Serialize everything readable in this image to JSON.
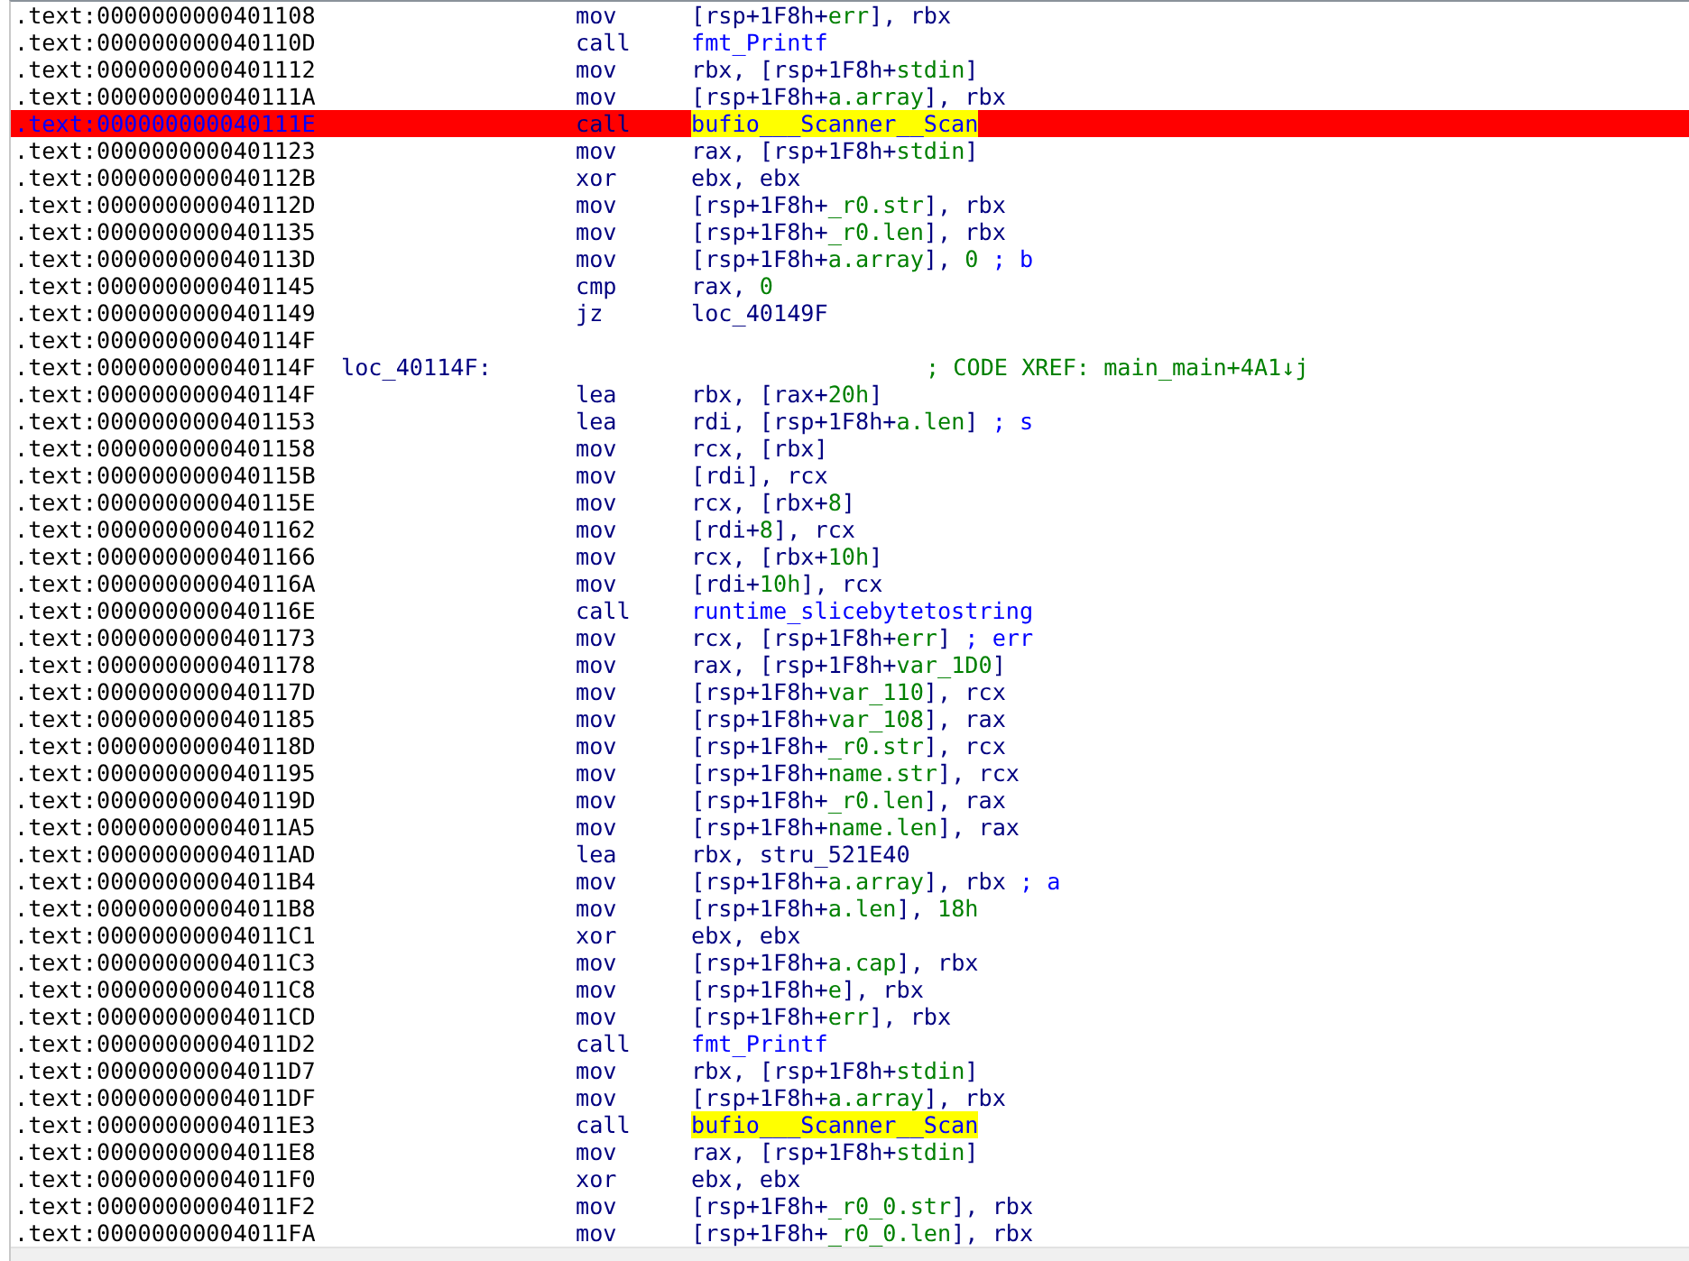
{
  "listing": {
    "rows": [
      {
        "address": ".text:0000000000401108",
        "breakpoint": false,
        "mnemonic": "mov",
        "operand": [
          {
            "text": "[rsp+1F8h+",
            "kind": "reg"
          },
          {
            "text": "err",
            "kind": "var"
          },
          {
            "text": "], rbx",
            "kind": "reg"
          }
        ]
      },
      {
        "address": ".text:000000000040110D",
        "breakpoint": false,
        "mnemonic": "call",
        "operand": [
          {
            "text": "fmt_Printf",
            "kind": "name"
          }
        ]
      },
      {
        "address": ".text:0000000000401112",
        "breakpoint": false,
        "mnemonic": "mov",
        "operand": [
          {
            "text": "rbx, [rsp+1F8h+",
            "kind": "reg"
          },
          {
            "text": "stdin",
            "kind": "var"
          },
          {
            "text": "]",
            "kind": "reg"
          }
        ]
      },
      {
        "address": ".text:000000000040111A",
        "breakpoint": false,
        "mnemonic": "mov",
        "operand": [
          {
            "text": "[rsp+1F8h+",
            "kind": "reg"
          },
          {
            "text": "a.array",
            "kind": "var"
          },
          {
            "text": "], rbx",
            "kind": "reg"
          }
        ]
      },
      {
        "address": ".text:000000000040111E",
        "breakpoint": true,
        "mnemonic": "call",
        "operand": [
          {
            "text": "bufio___Scanner__Scan",
            "kind": "highlight"
          }
        ]
      },
      {
        "address": ".text:0000000000401123",
        "breakpoint": false,
        "mnemonic": "mov",
        "operand": [
          {
            "text": "rax, [rsp+1F8h+",
            "kind": "reg"
          },
          {
            "text": "stdin",
            "kind": "var"
          },
          {
            "text": "]",
            "kind": "reg"
          }
        ]
      },
      {
        "address": ".text:000000000040112B",
        "breakpoint": false,
        "mnemonic": "xor",
        "operand": [
          {
            "text": "ebx, ebx",
            "kind": "reg"
          }
        ]
      },
      {
        "address": ".text:000000000040112D",
        "breakpoint": false,
        "mnemonic": "mov",
        "operand": [
          {
            "text": "[rsp+1F8h+",
            "kind": "reg"
          },
          {
            "text": "_r0.str",
            "kind": "var"
          },
          {
            "text": "], rbx",
            "kind": "reg"
          }
        ]
      },
      {
        "address": ".text:0000000000401135",
        "breakpoint": false,
        "mnemonic": "mov",
        "operand": [
          {
            "text": "[rsp+1F8h+",
            "kind": "reg"
          },
          {
            "text": "_r0.len",
            "kind": "var"
          },
          {
            "text": "], rbx",
            "kind": "reg"
          }
        ]
      },
      {
        "address": ".text:000000000040113D",
        "breakpoint": false,
        "mnemonic": "mov",
        "operand": [
          {
            "text": "[rsp+1F8h+",
            "kind": "reg"
          },
          {
            "text": "a.array",
            "kind": "var"
          },
          {
            "text": "], ",
            "kind": "reg"
          },
          {
            "text": "0",
            "kind": "var"
          },
          {
            "text": " ; b",
            "kind": "comment"
          }
        ]
      },
      {
        "address": ".text:0000000000401145",
        "breakpoint": false,
        "mnemonic": "cmp",
        "operand": [
          {
            "text": "rax, ",
            "kind": "reg"
          },
          {
            "text": "0",
            "kind": "var"
          }
        ]
      },
      {
        "address": ".text:0000000000401149",
        "breakpoint": false,
        "mnemonic": "jz",
        "operand": [
          {
            "text": "loc_40149F",
            "kind": "reg"
          }
        ]
      },
      {
        "address": ".text:000000000040114F",
        "breakpoint": false
      },
      {
        "address": ".text:000000000040114F",
        "breakpoint": false,
        "label": "loc_40114F:",
        "xref": "; CODE XREF: main_main+4A1↓j"
      },
      {
        "address": ".text:000000000040114F",
        "breakpoint": false,
        "mnemonic": "lea",
        "operand": [
          {
            "text": "rbx, [rax+",
            "kind": "reg"
          },
          {
            "text": "20h",
            "kind": "var"
          },
          {
            "text": "]",
            "kind": "reg"
          }
        ]
      },
      {
        "address": ".text:0000000000401153",
        "breakpoint": false,
        "mnemonic": "lea",
        "operand": [
          {
            "text": "rdi, [rsp+1F8h+",
            "kind": "reg"
          },
          {
            "text": "a.len",
            "kind": "var"
          },
          {
            "text": "]",
            "kind": "reg"
          },
          {
            "text": " ; s",
            "kind": "comment"
          }
        ]
      },
      {
        "address": ".text:0000000000401158",
        "breakpoint": false,
        "mnemonic": "mov",
        "operand": [
          {
            "text": "rcx, [rbx]",
            "kind": "reg"
          }
        ]
      },
      {
        "address": ".text:000000000040115B",
        "breakpoint": false,
        "mnemonic": "mov",
        "operand": [
          {
            "text": "[rdi], rcx",
            "kind": "reg"
          }
        ]
      },
      {
        "address": ".text:000000000040115E",
        "breakpoint": false,
        "mnemonic": "mov",
        "operand": [
          {
            "text": "rcx, [rbx+",
            "kind": "reg"
          },
          {
            "text": "8",
            "kind": "var"
          },
          {
            "text": "]",
            "kind": "reg"
          }
        ]
      },
      {
        "address": ".text:0000000000401162",
        "breakpoint": false,
        "mnemonic": "mov",
        "operand": [
          {
            "text": "[rdi+",
            "kind": "reg"
          },
          {
            "text": "8",
            "kind": "var"
          },
          {
            "text": "], rcx",
            "kind": "reg"
          }
        ]
      },
      {
        "address": ".text:0000000000401166",
        "breakpoint": false,
        "mnemonic": "mov",
        "operand": [
          {
            "text": "rcx, [rbx+",
            "kind": "reg"
          },
          {
            "text": "10h",
            "kind": "var"
          },
          {
            "text": "]",
            "kind": "reg"
          }
        ]
      },
      {
        "address": ".text:000000000040116A",
        "breakpoint": false,
        "mnemonic": "mov",
        "operand": [
          {
            "text": "[rdi+",
            "kind": "reg"
          },
          {
            "text": "10h",
            "kind": "var"
          },
          {
            "text": "], rcx",
            "kind": "reg"
          }
        ]
      },
      {
        "address": ".text:000000000040116E",
        "breakpoint": false,
        "mnemonic": "call",
        "operand": [
          {
            "text": "runtime_slicebytetostring",
            "kind": "name"
          }
        ]
      },
      {
        "address": ".text:0000000000401173",
        "breakpoint": false,
        "mnemonic": "mov",
        "operand": [
          {
            "text": "rcx, [rsp+1F8h+",
            "kind": "reg"
          },
          {
            "text": "err",
            "kind": "var"
          },
          {
            "text": "]",
            "kind": "reg"
          },
          {
            "text": " ; err",
            "kind": "comment"
          }
        ]
      },
      {
        "address": ".text:0000000000401178",
        "breakpoint": false,
        "mnemonic": "mov",
        "operand": [
          {
            "text": "rax, [rsp+1F8h+",
            "kind": "reg"
          },
          {
            "text": "var_1D0",
            "kind": "var"
          },
          {
            "text": "]",
            "kind": "reg"
          }
        ]
      },
      {
        "address": ".text:000000000040117D",
        "breakpoint": false,
        "mnemonic": "mov",
        "operand": [
          {
            "text": "[rsp+1F8h+",
            "kind": "reg"
          },
          {
            "text": "var_110",
            "kind": "var"
          },
          {
            "text": "], rcx",
            "kind": "reg"
          }
        ]
      },
      {
        "address": ".text:0000000000401185",
        "breakpoint": false,
        "mnemonic": "mov",
        "operand": [
          {
            "text": "[rsp+1F8h+",
            "kind": "reg"
          },
          {
            "text": "var_108",
            "kind": "var"
          },
          {
            "text": "], rax",
            "kind": "reg"
          }
        ]
      },
      {
        "address": ".text:000000000040118D",
        "breakpoint": false,
        "mnemonic": "mov",
        "operand": [
          {
            "text": "[rsp+1F8h+",
            "kind": "reg"
          },
          {
            "text": "_r0.str",
            "kind": "var"
          },
          {
            "text": "], rcx",
            "kind": "reg"
          }
        ]
      },
      {
        "address": ".text:0000000000401195",
        "breakpoint": false,
        "mnemonic": "mov",
        "operand": [
          {
            "text": "[rsp+1F8h+",
            "kind": "reg"
          },
          {
            "text": "name.str",
            "kind": "var"
          },
          {
            "text": "], rcx",
            "kind": "reg"
          }
        ]
      },
      {
        "address": ".text:000000000040119D",
        "breakpoint": false,
        "mnemonic": "mov",
        "operand": [
          {
            "text": "[rsp+1F8h+",
            "kind": "reg"
          },
          {
            "text": "_r0.len",
            "kind": "var"
          },
          {
            "text": "], rax",
            "kind": "reg"
          }
        ]
      },
      {
        "address": ".text:00000000004011A5",
        "breakpoint": false,
        "mnemonic": "mov",
        "operand": [
          {
            "text": "[rsp+1F8h+",
            "kind": "reg"
          },
          {
            "text": "name.len",
            "kind": "var"
          },
          {
            "text": "], rax",
            "kind": "reg"
          }
        ]
      },
      {
        "address": ".text:00000000004011AD",
        "breakpoint": false,
        "mnemonic": "lea",
        "operand": [
          {
            "text": "rbx, stru_521E40",
            "kind": "reg"
          }
        ]
      },
      {
        "address": ".text:00000000004011B4",
        "breakpoint": false,
        "mnemonic": "mov",
        "operand": [
          {
            "text": "[rsp+1F8h+",
            "kind": "reg"
          },
          {
            "text": "a.array",
            "kind": "var"
          },
          {
            "text": "], rbx",
            "kind": "reg"
          },
          {
            "text": " ; a",
            "kind": "comment"
          }
        ]
      },
      {
        "address": ".text:00000000004011B8",
        "breakpoint": false,
        "mnemonic": "mov",
        "operand": [
          {
            "text": "[rsp+1F8h+",
            "kind": "reg"
          },
          {
            "text": "a.len",
            "kind": "var"
          },
          {
            "text": "], ",
            "kind": "reg"
          },
          {
            "text": "18h",
            "kind": "var"
          }
        ]
      },
      {
        "address": ".text:00000000004011C1",
        "breakpoint": false,
        "mnemonic": "xor",
        "operand": [
          {
            "text": "ebx, ebx",
            "kind": "reg"
          }
        ]
      },
      {
        "address": ".text:00000000004011C3",
        "breakpoint": false,
        "mnemonic": "mov",
        "operand": [
          {
            "text": "[rsp+1F8h+",
            "kind": "reg"
          },
          {
            "text": "a.cap",
            "kind": "var"
          },
          {
            "text": "], rbx",
            "kind": "reg"
          }
        ]
      },
      {
        "address": ".text:00000000004011C8",
        "breakpoint": false,
        "mnemonic": "mov",
        "operand": [
          {
            "text": "[rsp+1F8h+",
            "kind": "reg"
          },
          {
            "text": "e",
            "kind": "var"
          },
          {
            "text": "], rbx",
            "kind": "reg"
          }
        ]
      },
      {
        "address": ".text:00000000004011CD",
        "breakpoint": false,
        "mnemonic": "mov",
        "operand": [
          {
            "text": "[rsp+1F8h+",
            "kind": "reg"
          },
          {
            "text": "err",
            "kind": "var"
          },
          {
            "text": "], rbx",
            "kind": "reg"
          }
        ]
      },
      {
        "address": ".text:00000000004011D2",
        "breakpoint": false,
        "mnemonic": "call",
        "operand": [
          {
            "text": "fmt_Printf",
            "kind": "name"
          }
        ]
      },
      {
        "address": ".text:00000000004011D7",
        "breakpoint": false,
        "mnemonic": "mov",
        "operand": [
          {
            "text": "rbx, [rsp+1F8h+",
            "kind": "reg"
          },
          {
            "text": "stdin",
            "kind": "var"
          },
          {
            "text": "]",
            "kind": "reg"
          }
        ]
      },
      {
        "address": ".text:00000000004011DF",
        "breakpoint": false,
        "mnemonic": "mov",
        "operand": [
          {
            "text": "[rsp+1F8h+",
            "kind": "reg"
          },
          {
            "text": "a.array",
            "kind": "var"
          },
          {
            "text": "], rbx",
            "kind": "reg"
          }
        ]
      },
      {
        "address": ".text:00000000004011E3",
        "breakpoint": false,
        "mnemonic": "call",
        "operand": [
          {
            "text": "bufio___Scanner__Scan",
            "kind": "highlight"
          }
        ]
      },
      {
        "address": ".text:00000000004011E8",
        "breakpoint": false,
        "mnemonic": "mov",
        "operand": [
          {
            "text": "rax, [rsp+1F8h+",
            "kind": "reg"
          },
          {
            "text": "stdin",
            "kind": "var"
          },
          {
            "text": "]",
            "kind": "reg"
          }
        ]
      },
      {
        "address": ".text:00000000004011F0",
        "breakpoint": false,
        "mnemonic": "xor",
        "operand": [
          {
            "text": "ebx, ebx",
            "kind": "reg"
          }
        ]
      },
      {
        "address": ".text:00000000004011F2",
        "breakpoint": false,
        "mnemonic": "mov",
        "operand": [
          {
            "text": "[rsp+1F8h+",
            "kind": "reg"
          },
          {
            "text": "_r0_0.str",
            "kind": "var"
          },
          {
            "text": "], rbx",
            "kind": "reg"
          }
        ]
      },
      {
        "address": ".text:00000000004011FA",
        "breakpoint": false,
        "mnemonic": "mov",
        "operand": [
          {
            "text": "[rsp+1F8h+",
            "kind": "reg"
          },
          {
            "text": "_r0_0.len",
            "kind": "var"
          },
          {
            "text": "], rbx",
            "kind": "reg"
          }
        ]
      }
    ]
  }
}
